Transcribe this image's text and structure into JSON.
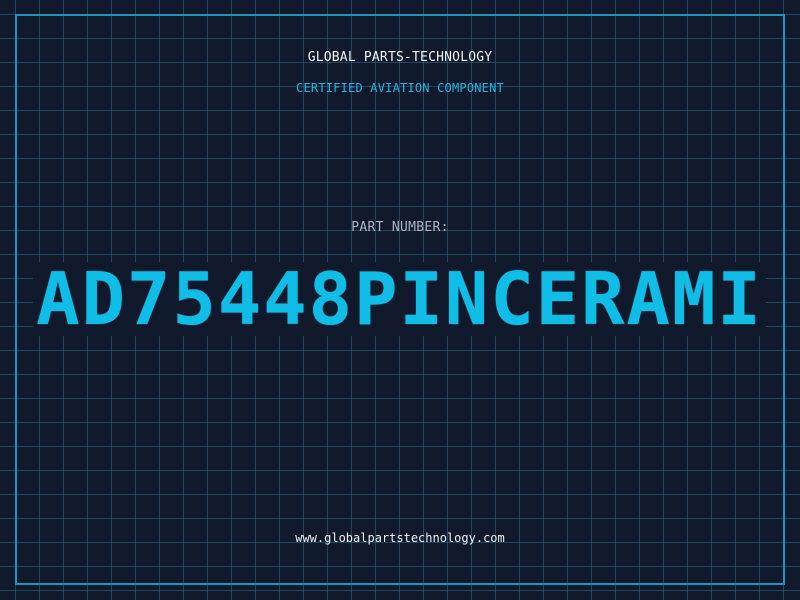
{
  "header": {
    "brand": "GLOBAL PARTS-TECHNOLOGY",
    "subtitle": "CERTIFIED AVIATION COMPONENT"
  },
  "part": {
    "label": "PART NUMBER:",
    "number": "AD75448PINCERAMI"
  },
  "footer": {
    "website": "www.globalpartstechnology.com"
  },
  "colors": {
    "background": "#111a2c",
    "grid": "#286e8c",
    "frame": "#1c95bd",
    "accent": "#10bde6",
    "subtitle": "#1fb4e3",
    "label": "#a9b6c6",
    "text": "#f2f5f8"
  }
}
